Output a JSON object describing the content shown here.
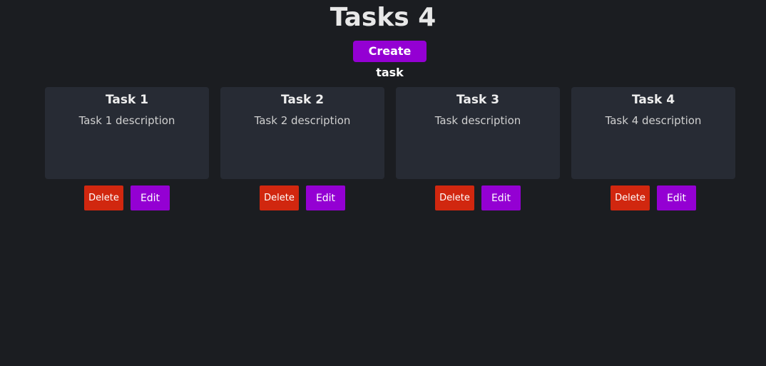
{
  "header": {
    "title": "Tasks 4",
    "create_label": "Create task"
  },
  "tasks": [
    {
      "title": "Task 1",
      "description": "Task 1 description",
      "delete_label": "Delete",
      "edit_label": "Edit"
    },
    {
      "title": "Task 2",
      "description": "Task 2 description",
      "delete_label": "Delete",
      "edit_label": "Edit"
    },
    {
      "title": "Task 3",
      "description": "Task description",
      "delete_label": "Delete",
      "edit_label": "Edit"
    },
    {
      "title": "Task 4",
      "description": "Task 4 description",
      "delete_label": "Delete",
      "edit_label": "Edit"
    }
  ],
  "colors": {
    "background": "#1b1d21",
    "card": "#272b34",
    "accent": "#9400d3",
    "danger": "#d1270f"
  }
}
